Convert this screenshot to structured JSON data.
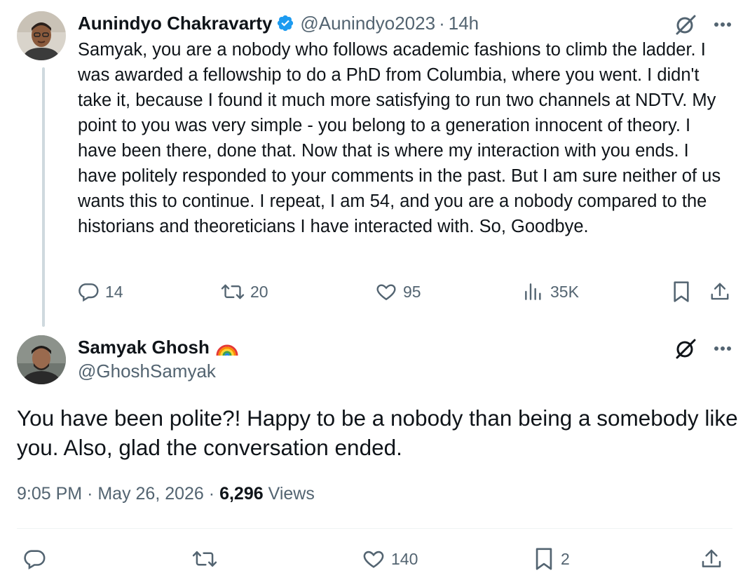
{
  "tweet1": {
    "author_name": "Aunindyo Chakravarty",
    "handle": "@Aunindyo2023",
    "separator": "·",
    "time": "14h",
    "text": "Samyak, you are a nobody who follows academic fashions to climb the ladder. I was awarded a fellowship to do a PhD from Columbia, where you went. I didn't take it, because I found it much more satisfying to run two channels at NDTV. My point to you was very simple - you belong to a generation innocent of theory. I have been there, done that. Now that is where my interaction with you ends. I have politely responded to your comments in the past. But I am sure neither of us wants this to continue. I repeat, I am 54, and you are a nobody compared to the historians and theoreticians I have interacted with. So, Goodbye.",
    "replies": "14",
    "reposts": "20",
    "likes": "95",
    "views": "35K",
    "accent_color": "#1d9bf0"
  },
  "tweet2": {
    "author_name": "Samyak Ghosh",
    "handle": "@GhoshSamyak",
    "text": "You have been polite?! Happy to be a nobody than being a somebody like you. Also, glad the conversation ended.",
    "time": "9:05 PM",
    "separator": "·",
    "date": "May 26, 2026",
    "views_count": "6,296",
    "views_label": "Views",
    "likes": "140",
    "bookmarks": "2"
  },
  "icons": {
    "verified": "verified-badge-icon",
    "grok": "grok-icon",
    "more": "more-icon",
    "reply": "reply-icon",
    "repost": "repost-icon",
    "like": "like-icon",
    "views": "views-icon",
    "bookmark": "bookmark-icon",
    "share": "share-icon",
    "rainbow": "rainbow-emoji-icon"
  },
  "colors": {
    "text": "#0f1419",
    "secondary": "#536471",
    "thread_line": "#cfd9de",
    "divider": "#eff3f4"
  }
}
